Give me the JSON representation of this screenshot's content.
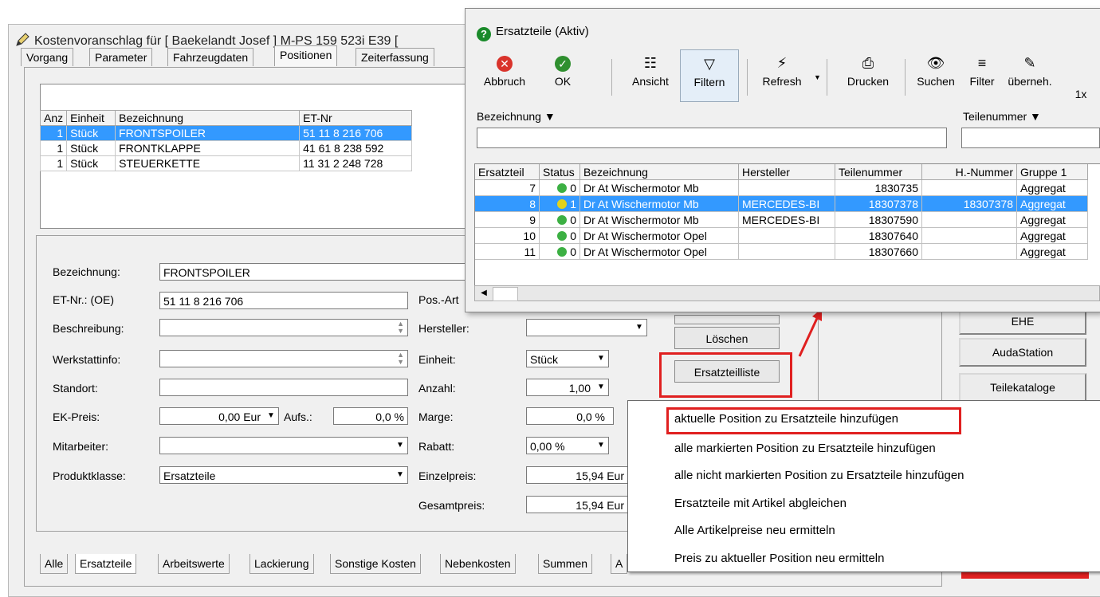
{
  "main_window": {
    "title": "Kostenvoranschlag  für [ Baekelandt Josef ] M-PS 159 523i  E39 ["
  },
  "top_tabs": [
    "Vorgang",
    "Parameter",
    "Fahrzeugdaten",
    "Positionen",
    "Zeiterfassung"
  ],
  "positions_table": {
    "headers": [
      "Anz",
      "Einheit",
      "Bezeichnung",
      "ET-Nr"
    ],
    "rows": [
      {
        "anz": "1",
        "einheit": "Stück",
        "bezeichnung": "FRONTSPOILER",
        "etnr": "51 11 8 216 706"
      },
      {
        "anz": "1",
        "einheit": "Stück",
        "bezeichnung": "FRONTKLAPPE",
        "etnr": "41 61 8 238 592"
      },
      {
        "anz": "1",
        "einheit": "Stück",
        "bezeichnung": "STEUERKETTE",
        "etnr": "11 31 2 248 728"
      }
    ]
  },
  "form": {
    "bezeichnung_label": "Bezeichnung:",
    "bezeichnung_value": "FRONTSPOILER",
    "etnr_label": "ET-Nr.: (OE)",
    "etnr_value": "51 11 8 216 706",
    "beschreibung_label": "Beschreibung:",
    "werkstattinfo_label": "Werkstattinfo:",
    "standort_label": "Standort:",
    "ekpreis_label": "EK-Preis:",
    "ekpreis_value": "0,00 Eur",
    "aufs_label": "Aufs.:",
    "aufs_value": "0,0 %",
    "mitarbeiter_label": "Mitarbeiter:",
    "produktklasse_label": "Produktklasse:",
    "produktklasse_value": "Ersatzteile",
    "posart_label": "Pos.-Art",
    "hersteller_label": "Hersteller:",
    "einheit_label": "Einheit:",
    "einheit_value": "Stück",
    "anzahl_label": "Anzahl:",
    "anzahl_value": "1,00",
    "marge_label": "Marge:",
    "marge_value": "0,0 %",
    "rabatt_label": "Rabatt:",
    "rabatt_value": "0,00 %",
    "einzelpreis_label": "Einzelpreis:",
    "einzelpreis_value": "15,94 Eur",
    "gesamtpreis_label": "Gesamtpreis:",
    "gesamtpreis_value": "15,94 Eur"
  },
  "buttons": {
    "loeschen": "Löschen",
    "ersatzteilliste": "Ersatzteilliste",
    "ehe": "EHE",
    "audastation": "AudaStation",
    "teilekataloge": "Teilekataloge"
  },
  "context_menu": [
    "aktuelle Position zu Ersatzteile hinzufügen",
    "alle markierten Position zu Ersatzteile hinzufügen",
    "alle nicht markierten Position zu Ersatzteile hinzufügen",
    "Ersatzteile mit Artikel abgleichen",
    "Alle Artikelpreise neu ermitteln",
    "Preis zu aktueller Position neu ermitteln"
  ],
  "bottom_tabs": [
    "Alle",
    "Ersatzteile",
    "Arbeitswerte",
    "Lackierung",
    "Sonstige Kosten",
    "Nebenkosten",
    "Summen",
    "A"
  ],
  "dialog": {
    "title": "Ersatzteile (Aktiv)",
    "toolbar": [
      "Abbruch",
      "OK",
      "Ansicht",
      "Filtern",
      "Refresh",
      "Drucken",
      "Suchen",
      "Filter",
      "überneh.",
      "1x"
    ],
    "filter_label_1": "Bezeichnung",
    "filter_label_2": "Teilenummer",
    "table_headers": [
      "Ersatzteil",
      "Status",
      "Bezeichnung",
      "Hersteller",
      "Teilenummer",
      "H.-Nummer",
      "Gruppe 1"
    ],
    "rows": [
      {
        "nr": "7",
        "status": "0",
        "bezeichnung": "Dr At Wischermotor Mb",
        "hersteller": "",
        "teilenummer": "1830735",
        "hnummer": "",
        "gruppe": "Aggregat"
      },
      {
        "nr": "8",
        "status": "1",
        "bezeichnung": "Dr At Wischermotor Mb",
        "hersteller": "MERCEDES-BI",
        "teilenummer": "18307378",
        "hnummer": "18307378",
        "gruppe": "Aggregat"
      },
      {
        "nr": "9",
        "status": "0",
        "bezeichnung": "Dr At Wischermotor Mb",
        "hersteller": "MERCEDES-BI",
        "teilenummer": "18307590",
        "hnummer": "",
        "gruppe": "Aggregat"
      },
      {
        "nr": "10",
        "status": "0",
        "bezeichnung": "Dr At Wischermotor Opel",
        "hersteller": "",
        "teilenummer": "18307640",
        "hnummer": "",
        "gruppe": "Aggregat"
      },
      {
        "nr": "11",
        "status": "0",
        "bezeichnung": "Dr At Wischermotor Opel",
        "hersteller": "",
        "teilenummer": "18307660",
        "hnummer": "",
        "gruppe": "Aggregat"
      }
    ]
  },
  "colors": {
    "selection": "#3399ff",
    "highlight_red": "#e02020",
    "status_green": "#3cb043",
    "status_yellow": "#e3d21b"
  }
}
